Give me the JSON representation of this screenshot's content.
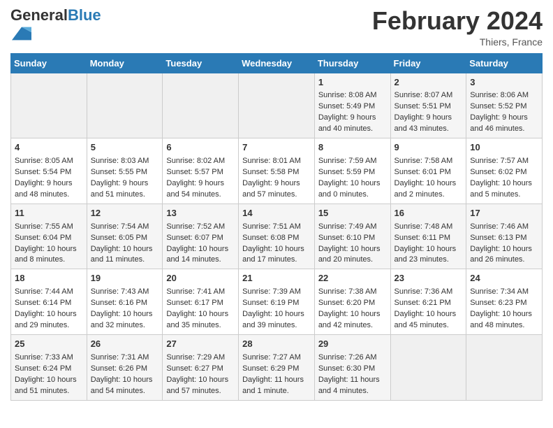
{
  "header": {
    "logo_general": "General",
    "logo_blue": "Blue",
    "month_title": "February 2024",
    "location": "Thiers, France"
  },
  "days_of_week": [
    "Sunday",
    "Monday",
    "Tuesday",
    "Wednesday",
    "Thursday",
    "Friday",
    "Saturday"
  ],
  "weeks": [
    [
      {
        "day": "",
        "info": ""
      },
      {
        "day": "",
        "info": ""
      },
      {
        "day": "",
        "info": ""
      },
      {
        "day": "",
        "info": ""
      },
      {
        "day": "1",
        "info": "Sunrise: 8:08 AM\nSunset: 5:49 PM\nDaylight: 9 hours\nand 40 minutes."
      },
      {
        "day": "2",
        "info": "Sunrise: 8:07 AM\nSunset: 5:51 PM\nDaylight: 9 hours\nand 43 minutes."
      },
      {
        "day": "3",
        "info": "Sunrise: 8:06 AM\nSunset: 5:52 PM\nDaylight: 9 hours\nand 46 minutes."
      }
    ],
    [
      {
        "day": "4",
        "info": "Sunrise: 8:05 AM\nSunset: 5:54 PM\nDaylight: 9 hours\nand 48 minutes."
      },
      {
        "day": "5",
        "info": "Sunrise: 8:03 AM\nSunset: 5:55 PM\nDaylight: 9 hours\nand 51 minutes."
      },
      {
        "day": "6",
        "info": "Sunrise: 8:02 AM\nSunset: 5:57 PM\nDaylight: 9 hours\nand 54 minutes."
      },
      {
        "day": "7",
        "info": "Sunrise: 8:01 AM\nSunset: 5:58 PM\nDaylight: 9 hours\nand 57 minutes."
      },
      {
        "day": "8",
        "info": "Sunrise: 7:59 AM\nSunset: 5:59 PM\nDaylight: 10 hours\nand 0 minutes."
      },
      {
        "day": "9",
        "info": "Sunrise: 7:58 AM\nSunset: 6:01 PM\nDaylight: 10 hours\nand 2 minutes."
      },
      {
        "day": "10",
        "info": "Sunrise: 7:57 AM\nSunset: 6:02 PM\nDaylight: 10 hours\nand 5 minutes."
      }
    ],
    [
      {
        "day": "11",
        "info": "Sunrise: 7:55 AM\nSunset: 6:04 PM\nDaylight: 10 hours\nand 8 minutes."
      },
      {
        "day": "12",
        "info": "Sunrise: 7:54 AM\nSunset: 6:05 PM\nDaylight: 10 hours\nand 11 minutes."
      },
      {
        "day": "13",
        "info": "Sunrise: 7:52 AM\nSunset: 6:07 PM\nDaylight: 10 hours\nand 14 minutes."
      },
      {
        "day": "14",
        "info": "Sunrise: 7:51 AM\nSunset: 6:08 PM\nDaylight: 10 hours\nand 17 minutes."
      },
      {
        "day": "15",
        "info": "Sunrise: 7:49 AM\nSunset: 6:10 PM\nDaylight: 10 hours\nand 20 minutes."
      },
      {
        "day": "16",
        "info": "Sunrise: 7:48 AM\nSunset: 6:11 PM\nDaylight: 10 hours\nand 23 minutes."
      },
      {
        "day": "17",
        "info": "Sunrise: 7:46 AM\nSunset: 6:13 PM\nDaylight: 10 hours\nand 26 minutes."
      }
    ],
    [
      {
        "day": "18",
        "info": "Sunrise: 7:44 AM\nSunset: 6:14 PM\nDaylight: 10 hours\nand 29 minutes."
      },
      {
        "day": "19",
        "info": "Sunrise: 7:43 AM\nSunset: 6:16 PM\nDaylight: 10 hours\nand 32 minutes."
      },
      {
        "day": "20",
        "info": "Sunrise: 7:41 AM\nSunset: 6:17 PM\nDaylight: 10 hours\nand 35 minutes."
      },
      {
        "day": "21",
        "info": "Sunrise: 7:39 AM\nSunset: 6:19 PM\nDaylight: 10 hours\nand 39 minutes."
      },
      {
        "day": "22",
        "info": "Sunrise: 7:38 AM\nSunset: 6:20 PM\nDaylight: 10 hours\nand 42 minutes."
      },
      {
        "day": "23",
        "info": "Sunrise: 7:36 AM\nSunset: 6:21 PM\nDaylight: 10 hours\nand 45 minutes."
      },
      {
        "day": "24",
        "info": "Sunrise: 7:34 AM\nSunset: 6:23 PM\nDaylight: 10 hours\nand 48 minutes."
      }
    ],
    [
      {
        "day": "25",
        "info": "Sunrise: 7:33 AM\nSunset: 6:24 PM\nDaylight: 10 hours\nand 51 minutes."
      },
      {
        "day": "26",
        "info": "Sunrise: 7:31 AM\nSunset: 6:26 PM\nDaylight: 10 hours\nand 54 minutes."
      },
      {
        "day": "27",
        "info": "Sunrise: 7:29 AM\nSunset: 6:27 PM\nDaylight: 10 hours\nand 57 minutes."
      },
      {
        "day": "28",
        "info": "Sunrise: 7:27 AM\nSunset: 6:29 PM\nDaylight: 11 hours\nand 1 minute."
      },
      {
        "day": "29",
        "info": "Sunrise: 7:26 AM\nSunset: 6:30 PM\nDaylight: 11 hours\nand 4 minutes."
      },
      {
        "day": "",
        "info": ""
      },
      {
        "day": "",
        "info": ""
      }
    ]
  ]
}
